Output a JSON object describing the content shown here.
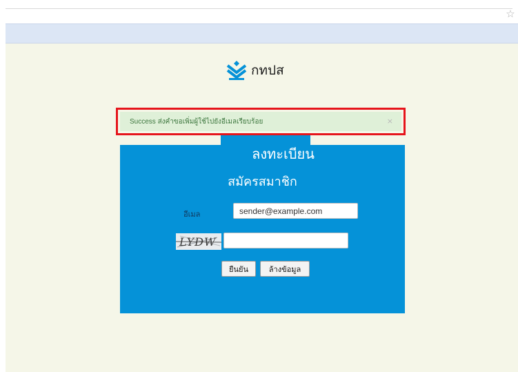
{
  "browser": {
    "bookmark_icon": "star-icon"
  },
  "logo": {
    "text": "กทปส",
    "icon": "chevron-stack-icon",
    "color": "#0592d8"
  },
  "alert": {
    "text": "Success  ส่งคำขอเพิ่มผู้ใช้ไปยังอีเมลเรียบร้อย",
    "close_label": "×",
    "highlight_color": "#e6141b"
  },
  "form": {
    "title": "ลงทะเบียน",
    "subtitle": "สมัครสมาชิก",
    "email_label": "อีเมล",
    "email_value": "sender@example.com",
    "captcha_text": "LYDW",
    "captcha_value": "",
    "submit_label": "ยืนยัน",
    "clear_label": "ล้างข้อมูล",
    "panel_color": "#0592d8"
  }
}
